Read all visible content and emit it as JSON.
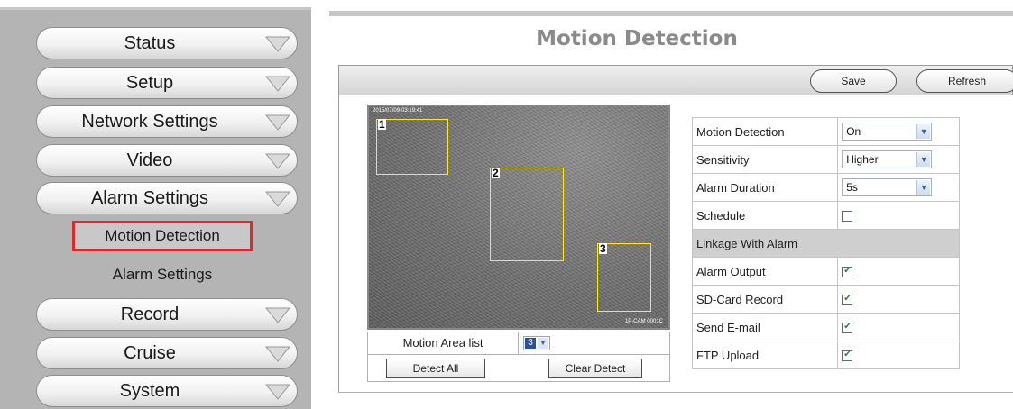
{
  "sidebar": {
    "items": [
      {
        "label": "Status"
      },
      {
        "label": "Setup"
      },
      {
        "label": "Network Settings"
      },
      {
        "label": "Video"
      },
      {
        "label": "Alarm Settings"
      },
      {
        "label": "Record"
      },
      {
        "label": "Cruise"
      },
      {
        "label": "System"
      }
    ],
    "alarm_sub": [
      {
        "label": "Motion Detection",
        "active": true
      },
      {
        "label": "Alarm Settings",
        "active": false
      }
    ]
  },
  "main": {
    "title": "Motion Detection",
    "toolbar": {
      "save_label": "Save",
      "refresh_label": "Refresh"
    },
    "video": {
      "timestamp_top": "2015/07/09-03:19:41",
      "timestamp_bottom": "1P-CAM 0001C",
      "zones": [
        {
          "num": "1"
        },
        {
          "num": "2"
        },
        {
          "num": "3"
        }
      ]
    },
    "motion_area_list": {
      "label": "Motion Area list",
      "value": "3"
    },
    "buttons": {
      "detect_all": "Detect All",
      "clear_detect": "Clear Detect"
    },
    "settings": {
      "motion_detection": {
        "label": "Motion Detection",
        "value": "On"
      },
      "sensitivity": {
        "label": "Sensitivity",
        "value": "Higher"
      },
      "alarm_duration": {
        "label": "Alarm Duration",
        "value": "5s"
      },
      "schedule": {
        "label": "Schedule",
        "checked": false
      },
      "linkage_header": "Linkage With Alarm",
      "alarm_output": {
        "label": "Alarm Output",
        "checked": true
      },
      "sd_record": {
        "label": "SD-Card Record",
        "checked": true
      },
      "send_email": {
        "label": "Send E-mail",
        "checked": true
      },
      "ftp_upload": {
        "label": "FTP Upload",
        "checked": true
      }
    }
  },
  "colors": {
    "sidebar_bg": "#b4b4b4",
    "active_border": "#e02a2a",
    "zone_border": "#ffee00",
    "title_text": "#8a8a8a"
  }
}
